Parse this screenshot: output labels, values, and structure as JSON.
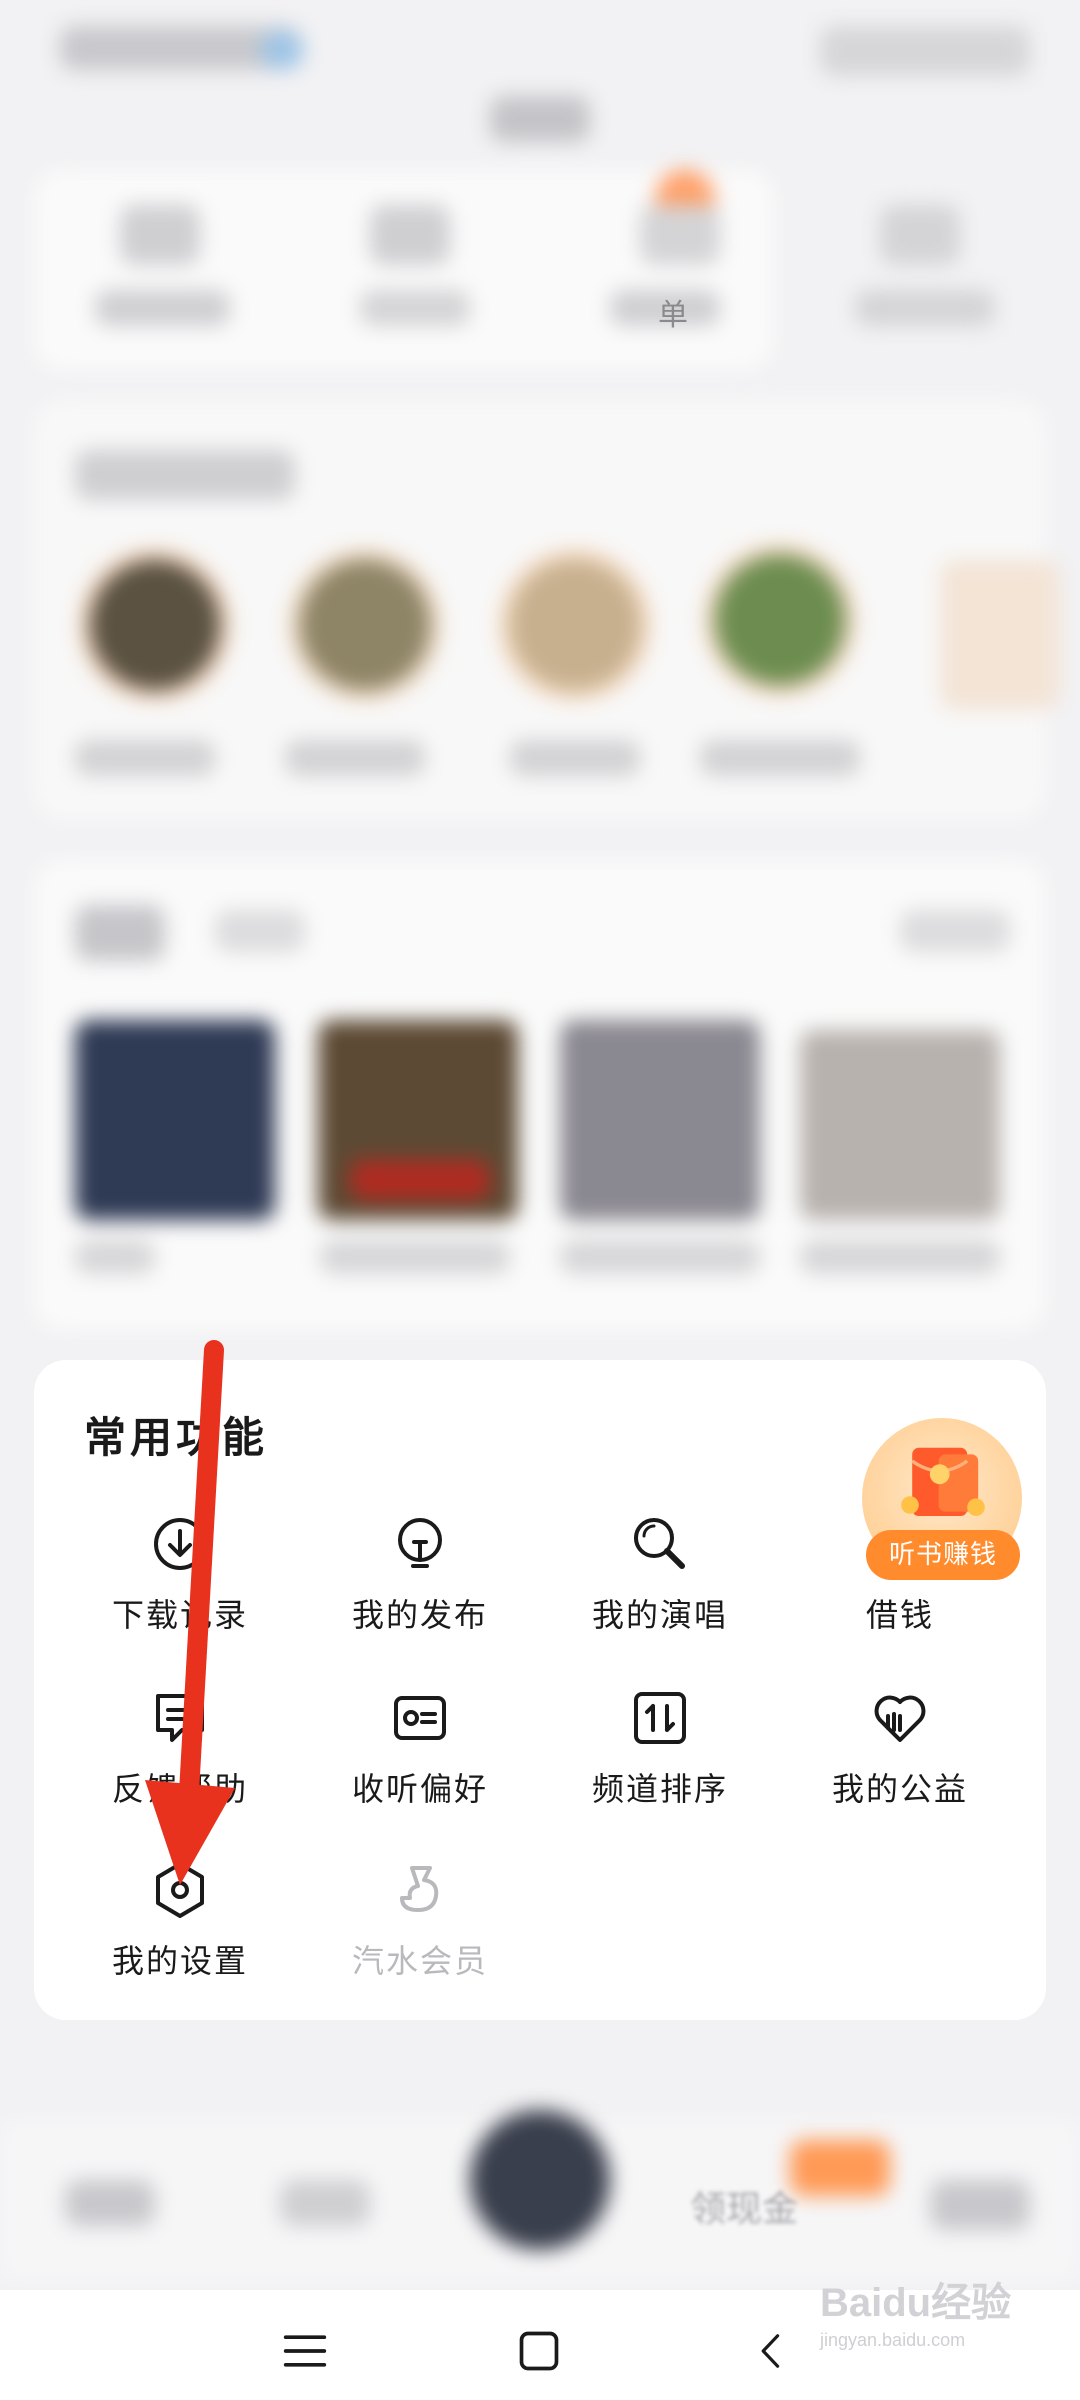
{
  "header": {
    "top_tabs": [
      "",
      "",
      "",
      "单"
    ]
  },
  "common_functions": {
    "title": "常用功能",
    "items": [
      {
        "label": "下载记录",
        "icon": "download-icon"
      },
      {
        "label": "我的发布",
        "icon": "lightbulb-icon"
      },
      {
        "label": "我的演唱",
        "icon": "microphone-icon"
      },
      {
        "label": "借钱",
        "icon": "wallet-icon"
      },
      {
        "label": "反馈帮助",
        "icon": "feedback-icon"
      },
      {
        "label": "收听偏好",
        "icon": "preference-card-icon"
      },
      {
        "label": "频道排序",
        "icon": "sort-icon"
      },
      {
        "label": "我的公益",
        "icon": "heart-hand-icon"
      },
      {
        "label": "我的设置",
        "icon": "settings-hexagon-icon"
      },
      {
        "label": "汽水会员",
        "icon": "soda-member-icon"
      }
    ],
    "promo_label": "听书赚钱"
  },
  "bottom_nav": {
    "right_partial_text": "领现金"
  },
  "system_nav": {
    "menu_icon": "menu-icon",
    "home_icon": "home-square-icon",
    "back_icon": "back-chevron-icon"
  },
  "watermark": {
    "brand": "Baidu经验",
    "url": "jingyan.baidu.com"
  },
  "annotation": {
    "arrow_color": "#e8321e"
  },
  "colors": {
    "accent": "#ff8b2c",
    "disabled_text": "#b9b9bd"
  }
}
